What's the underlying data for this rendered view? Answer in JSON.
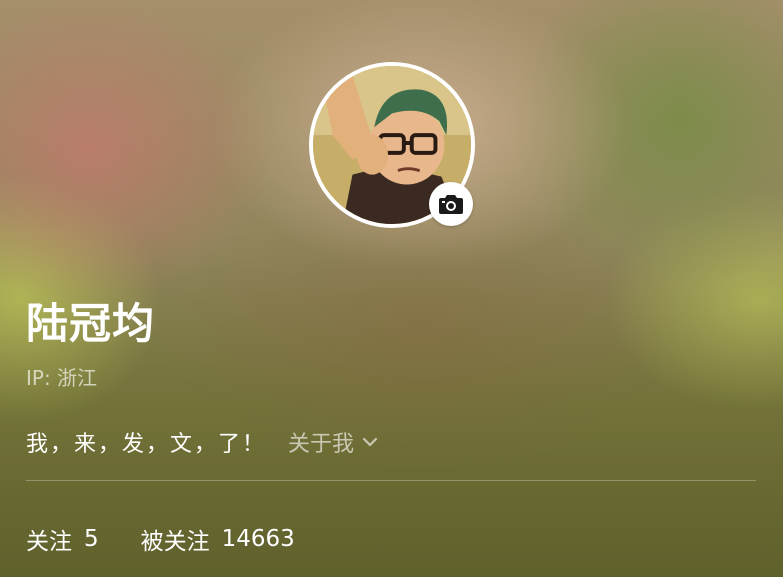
{
  "profile": {
    "name": "陆冠均",
    "ip_location": "IP: 浙江",
    "bio": "我，来，发，文，了！",
    "about_label": "关于我"
  },
  "stats": {
    "following_label": "关注",
    "following_count": "5",
    "followers_label": "被关注",
    "followers_count": "14663"
  },
  "icons": {
    "camera": "camera-icon",
    "chevron": "chevron-down-icon"
  }
}
